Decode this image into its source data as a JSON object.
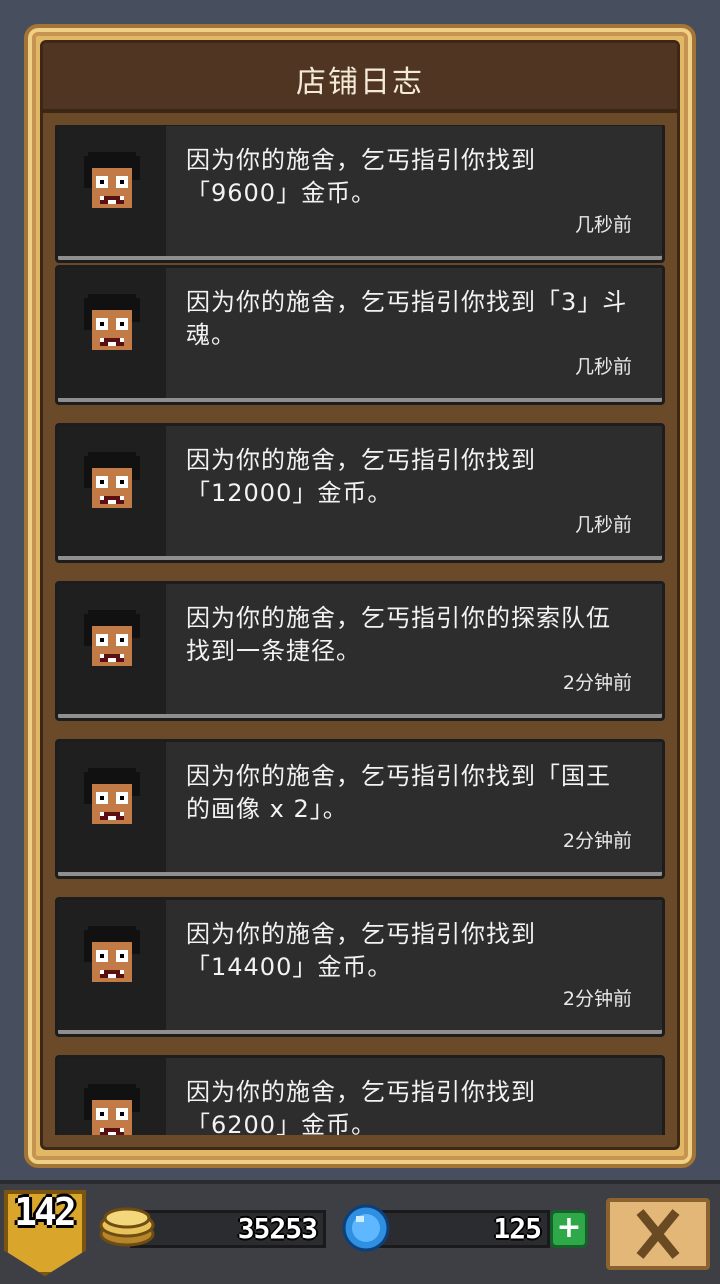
{
  "header": {
    "title": "店铺日志"
  },
  "log": [
    {
      "message": "因为你的施舍，乞丐指引你找到\n「9600」金币。",
      "time": "几秒前"
    },
    {
      "message": "因为你的施舍，乞丐指引你找到「3」斗\n魂。",
      "time": "几秒前"
    },
    {
      "message": "因为你的施舍，乞丐指引你找到\n「12000」金币。",
      "time": "几秒前"
    },
    {
      "message": "因为你的施舍，乞丐指引你的探索队伍\n找到一条捷径。",
      "time": "2分钟前"
    },
    {
      "message": "因为你的施舍，乞丐指引你找到「国王\n的画像 x 2」。",
      "time": "2分钟前"
    },
    {
      "message": "因为你的施舍，乞丐指引你找到\n「14400」金币。",
      "time": "2分钟前"
    },
    {
      "message": "因为你的施舍，乞丐指引你找到\n「6200」金币。",
      "time": ""
    }
  ],
  "hud": {
    "level": "142",
    "gold": "35253",
    "gems": "125"
  },
  "colors": {
    "frame_gold": "#e2b866",
    "panel_brown": "#6b4a2a",
    "card_bg": "#2d2d2d",
    "plus_green": "#2fa84a"
  },
  "icons": {
    "avatar": "beggar-face-icon",
    "gold": "gold-coin-icon",
    "gem": "blue-gem-icon",
    "plus": "plus-icon",
    "close": "close-x-icon"
  }
}
